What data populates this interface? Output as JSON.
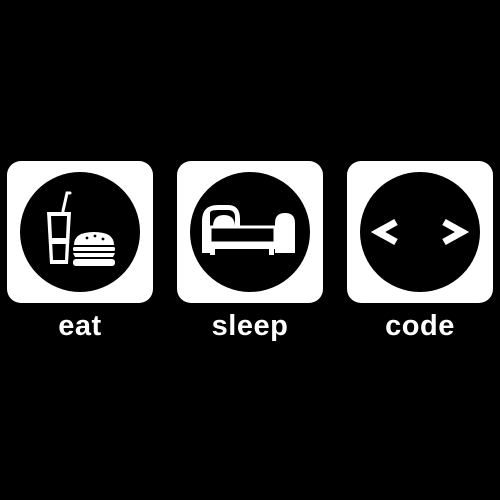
{
  "colors": {
    "background": "#000000",
    "tile": "#ffffff",
    "disc": "#000000",
    "glyph": "#ffffff"
  },
  "items": [
    {
      "label": "eat",
      "icon": "food-drink-burger-icon"
    },
    {
      "label": "sleep",
      "icon": "bed-icon"
    },
    {
      "label": "code",
      "icon": "code-brackets-icon"
    }
  ]
}
